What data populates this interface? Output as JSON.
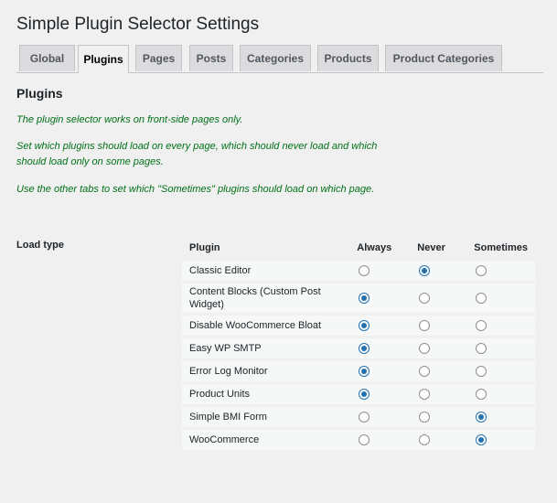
{
  "page": {
    "title": "Simple Plugin Selector Settings"
  },
  "tabs": [
    "Global",
    "Plugins",
    "Pages",
    "Posts",
    "Categories",
    "Products",
    "Product Categories"
  ],
  "active_tab": "Plugins",
  "section": {
    "title": "Plugins",
    "notes": [
      "The plugin selector works on front-side pages only.",
      "Set which plugins should load on every page, which should never load and which should load only on some pages.",
      "Use the other tabs to set which \"Sometimes\" plugins should load on which page."
    ]
  },
  "load_type_label": "Load type",
  "table": {
    "headers": {
      "plugin": "Plugin",
      "always": "Always",
      "never": "Never",
      "sometimes": "Sometimes"
    },
    "rows": [
      {
        "plugin": "Classic Editor",
        "selected": "never"
      },
      {
        "plugin": "Content Blocks (Custom Post Widget)",
        "selected": "always"
      },
      {
        "plugin": "Disable WooCommerce Bloat",
        "selected": "always"
      },
      {
        "plugin": "Easy WP SMTP",
        "selected": "always"
      },
      {
        "plugin": "Error Log Monitor",
        "selected": "always"
      },
      {
        "plugin": "Product Units",
        "selected": "always"
      },
      {
        "plugin": "Simple BMI Form",
        "selected": "sometimes"
      },
      {
        "plugin": "WooCommerce",
        "selected": "sometimes"
      }
    ]
  }
}
